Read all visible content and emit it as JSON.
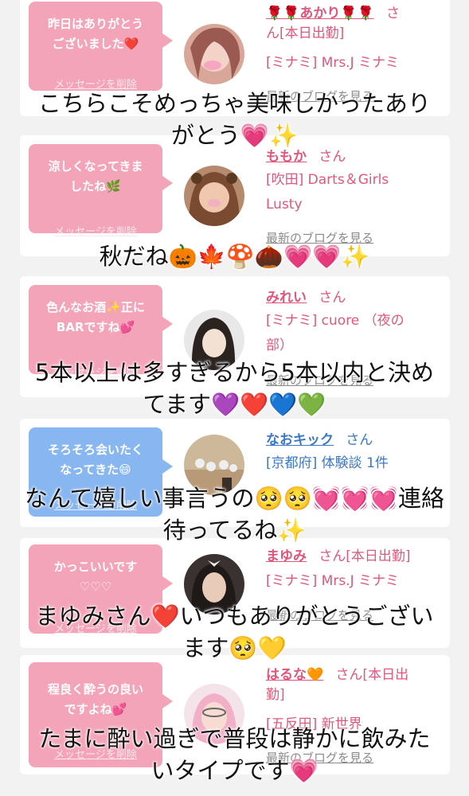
{
  "cards": [
    {
      "bubble_lines": [
        "昨日はありがとう",
        "ございました❤️"
      ],
      "delete_label": "メッセージを削除",
      "name": "🌹🌹あかり🌹🌹",
      "honorific": "さ",
      "honorific_cont": "ん[本日出勤]",
      "shop": "[ミナミ] Mrs.J ミナミ",
      "blog_label": "最新のブログを見る",
      "bubble_color": "pink"
    },
    {
      "bubble_lines": [
        "涼しくなってきま",
        "したね🌿"
      ],
      "delete_label": "メッセージを削除",
      "name": "ももか",
      "honorific": "さん",
      "shop_lines": [
        "[吹田] Darts＆Girls",
        "Lusty"
      ],
      "blog_label": "最新のブログを見る",
      "bubble_color": "pink"
    },
    {
      "bubble_lines": [
        "色んなお酒✨正に",
        "BARですね💕"
      ],
      "delete_label": "メッセージを削除",
      "name": "みれい",
      "honorific": "さん",
      "shop_lines": [
        "[ミナミ] cuore （夜の",
        "部）"
      ],
      "blog_label": "最新のブログを見る",
      "bubble_color": "pink"
    },
    {
      "bubble_lines": [
        "そろそろ会いたく",
        "なってきた😄"
      ],
      "delete_label": "メッセージを削除",
      "name": "なおキック",
      "honorific": "さん",
      "shop": "[京都府] 体験談 1件",
      "bubble_color": "blue"
    },
    {
      "bubble_lines": [
        "かっこいいです",
        "♡♡♡"
      ],
      "delete_label": "メッセージを削除",
      "name": "まゆみ",
      "honorific": "さん[本日出勤]",
      "shop": "[ミナミ] Mrs.J ミナミ",
      "blog_label": "最新のブログを見る",
      "bubble_color": "pink"
    },
    {
      "bubble_lines": [
        "程良く酔うの良い",
        "ですよね💕"
      ],
      "delete_label": "メッセージを削除",
      "name": "はるな🧡",
      "honorific": "さん[本日出",
      "honorific_cont": "勤]",
      "shop": "[五反田] 新世界",
      "blog_label": "最新のブログを見る",
      "bubble_color": "pink"
    }
  ],
  "captions": [
    [
      "こちらこそめっちゃ美味しかったあり",
      "がとう💗✨"
    ],
    [
      "秋だね🎃🍁🍄🌰💗💗✨"
    ],
    [
      "5本以上は多すぎるから5本以内と決め",
      "てます💜❤️💙💚"
    ],
    [
      "なんて嬉しい事言うの🥺🥺💓💓💓連絡",
      "待ってるね✨"
    ],
    [
      "まゆみさん❤️いつもありがとうござい",
      "ます🥺💛"
    ],
    [
      "たまに酔い過ぎで普段は静かに飲みた",
      "いタイプです💗"
    ]
  ]
}
